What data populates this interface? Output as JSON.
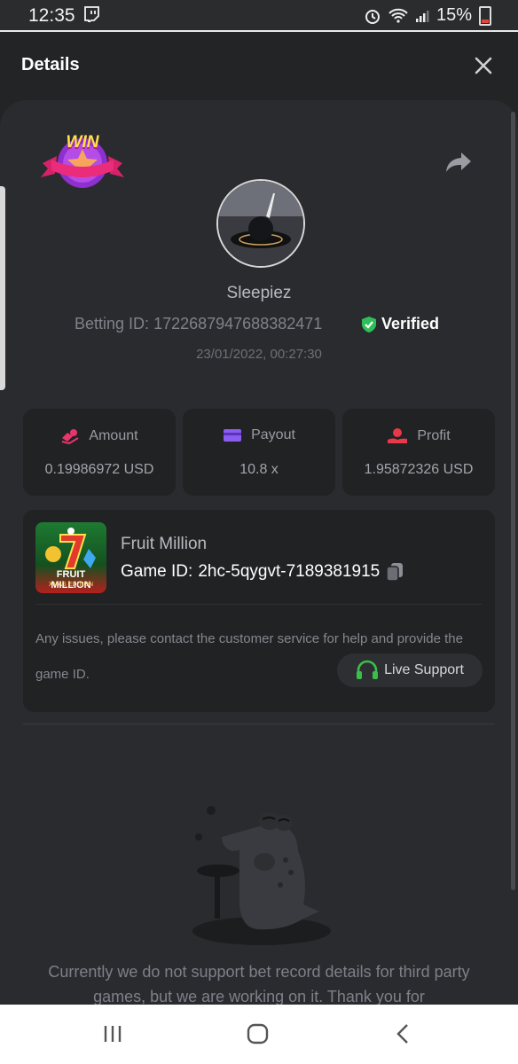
{
  "status_bar": {
    "time": "12:35",
    "battery": "15%"
  },
  "header": {
    "title": "Details"
  },
  "win_badge": {
    "text": "WIN"
  },
  "profile": {
    "username": "Sleepiez",
    "betting_id_label": "Betting ID:",
    "betting_id": "1722687947688382471",
    "verified_label": "Verified",
    "datetime": "23/01/2022, 00:27:30"
  },
  "stats": [
    {
      "label": "Amount",
      "value": "0.19986972 USD",
      "icon": "coins-icon",
      "icon_color": "#e8356a"
    },
    {
      "label": "Payout",
      "value": "10.8 x",
      "icon": "card-icon",
      "icon_color": "#8a5cf0"
    },
    {
      "label": "Profit",
      "value": "1.95872326 USD",
      "icon": "hand-coin-icon",
      "icon_color": "#e8384a"
    }
  ],
  "game": {
    "thumb_title": "FRUIT MILLION",
    "thumb_subtitle": "XMAS EDITION",
    "name": "Fruit Million",
    "game_id_label": "Game ID:",
    "game_id": "2hc-5qygvt-7189381915",
    "issues_text": "Any issues, please contact the customer service for help and provide the game ID.",
    "support_label": "Live Support"
  },
  "notice": "Currently we do not support bet record details for third party games, but we are working on it. Thank you for",
  "colors": {
    "accent_green": "#3bbf4a",
    "verified_green": "#2fbf58",
    "background": "#232426",
    "card": "#2a2b2e"
  }
}
